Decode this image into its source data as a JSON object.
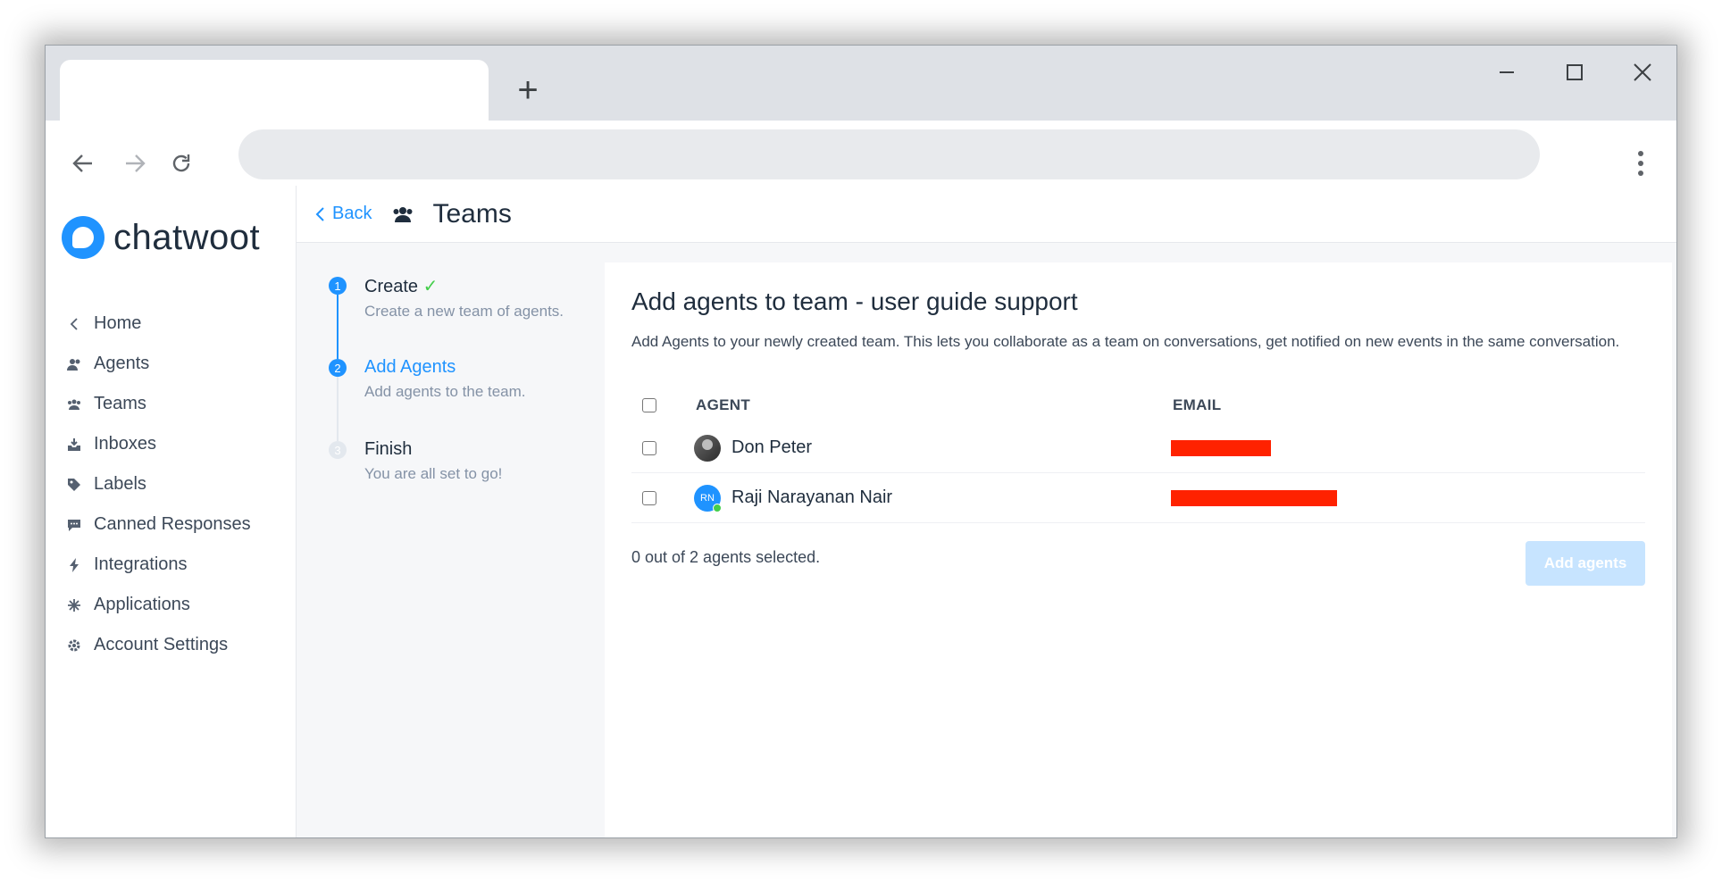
{
  "browser": {
    "new_tab_label": "+",
    "icons": {
      "back": "arrow-left-icon",
      "forward": "arrow-right-icon",
      "reload": "reload-icon",
      "menu": "more-vert-icon",
      "minimize": "minimize-icon",
      "maximize": "maximize-icon",
      "close": "close-icon"
    }
  },
  "brand": {
    "name": "chatwoot",
    "color": "#1f93ff"
  },
  "sidebar": {
    "items": [
      {
        "label": "Home",
        "icon": "chevron-left-icon"
      },
      {
        "label": "Agents",
        "icon": "people-icon"
      },
      {
        "label": "Teams",
        "icon": "team-icon"
      },
      {
        "label": "Inboxes",
        "icon": "inbox-icon"
      },
      {
        "label": "Labels",
        "icon": "tag-icon"
      },
      {
        "label": "Canned Responses",
        "icon": "chat-bubble-icon"
      },
      {
        "label": "Integrations",
        "icon": "flash-icon"
      },
      {
        "label": "Applications",
        "icon": "apps-icon"
      },
      {
        "label": "Account Settings",
        "icon": "gear-icon"
      }
    ]
  },
  "header": {
    "back_label": "Back",
    "title": "Teams",
    "icon": "team-icon"
  },
  "wizard": {
    "steps": [
      {
        "number": "1",
        "title": "Create",
        "subtitle": "Create a new team of agents.",
        "status": "done"
      },
      {
        "number": "2",
        "title": "Add Agents",
        "subtitle": "Add agents to the team.",
        "status": "active"
      },
      {
        "number": "3",
        "title": "Finish",
        "subtitle": "You are all set to go!",
        "status": "pending"
      }
    ]
  },
  "content": {
    "title": "Add agents to team - user guide support",
    "description": "Add Agents to your newly created team. This lets you collaborate as a team on conversations, get notified on new events in the same conversation.",
    "table": {
      "headers": {
        "agent": "AGENT",
        "email": "EMAIL"
      },
      "rows": [
        {
          "name": "Don Peter",
          "avatar": "photo",
          "email_redacted": true
        },
        {
          "name": "Raji Narayanan Nair",
          "avatar_initials": "RN",
          "online": true,
          "email_redacted": true
        }
      ]
    },
    "selection_count": "0 out of 2 agents selected.",
    "add_button": "Add agents"
  }
}
